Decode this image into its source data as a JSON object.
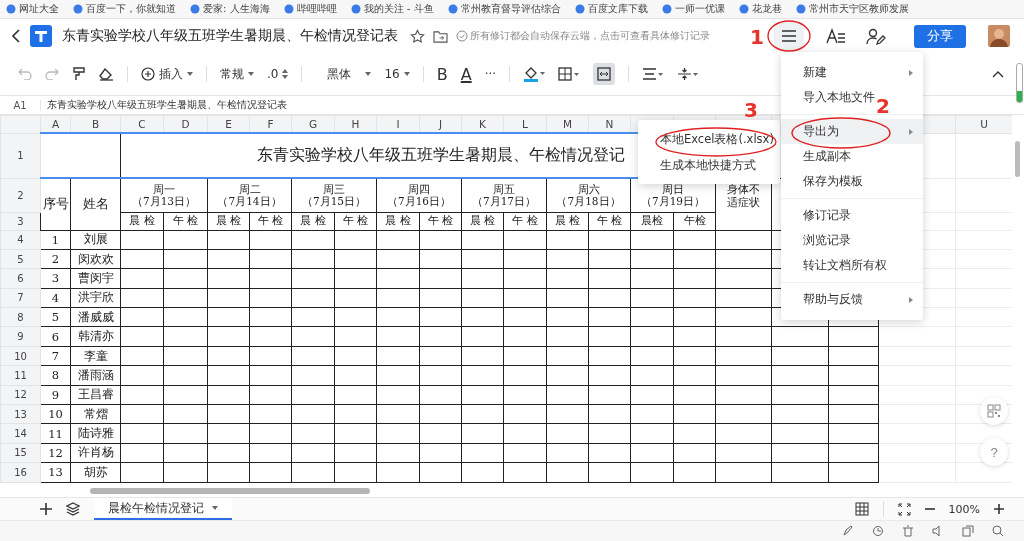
{
  "bookmarks": [
    {
      "label": "网址大全"
    },
    {
      "label": "百度一下，你就知道"
    },
    {
      "label": "爱家: 人生海海"
    },
    {
      "label": "哔哩哔哩"
    },
    {
      "label": "我的关注 - 斗鱼"
    },
    {
      "label": "常州教育督导评估综合"
    },
    {
      "label": "百度文库下载"
    },
    {
      "label": "一师一优课"
    },
    {
      "label": "花龙巷"
    },
    {
      "label": "常州市天宁区教师发展"
    }
  ],
  "header": {
    "title": "东青实验学校八年级五班学生暑期晨、午检情况登记表",
    "save_note": "所有修订都会自动保存云端，点击可查看具体修订记录",
    "share_button": "分享"
  },
  "toolbar": {
    "insert": "插入",
    "number_format": "常规",
    "decimal": ".0",
    "font": "黑体",
    "font_size": "16",
    "bold": "B",
    "font_color": "A",
    "more": "···",
    "merge_cells": {
      "on": true
    }
  },
  "formula_bar": {
    "cell": "A1",
    "content": "东青实验学校八年级五班学生暑期晨、午检情况登记表"
  },
  "columns": [
    "A",
    "B",
    "C",
    "D",
    "E",
    "F",
    "G",
    "H",
    "I",
    "J",
    "K",
    "L",
    "M",
    "N"
  ],
  "far_column": "U",
  "row_numbers": [
    "1",
    "2",
    "3",
    "4",
    "5",
    "6",
    "7",
    "8",
    "9",
    "10",
    "11",
    "12",
    "13",
    "14",
    "15",
    "16"
  ],
  "sheet": {
    "title": "东青实验学校八年级五班学生暑期晨、午检情况登记",
    "number_header": "序号",
    "name_header": "姓名",
    "symptoms_header": "身体不适症状",
    "days": [
      {
        "day": "周一",
        "date": "（7月13日）",
        "checks": [
          "晨 检",
          "午 检"
        ]
      },
      {
        "day": "周二",
        "date": "（7月14日）",
        "checks": [
          "晨 检",
          "午 检"
        ]
      },
      {
        "day": "周三",
        "date": "（7月15日）",
        "checks": [
          "晨 检",
          "午 检"
        ]
      },
      {
        "day": "周四",
        "date": "（7月16日）",
        "checks": [
          "晨 检",
          "午 检"
        ]
      },
      {
        "day": "周五",
        "date": "（7月17日）",
        "checks": [
          "晨 检",
          "午 检"
        ]
      },
      {
        "day": "周六",
        "date": "（7月18日）",
        "checks": [
          "晨 检",
          "午 检"
        ]
      },
      {
        "day": "周日",
        "date": "（7月19日）",
        "checks": [
          "晨检",
          "午检"
        ]
      }
    ],
    "students": [
      {
        "no": "1",
        "name": "刘展"
      },
      {
        "no": "2",
        "name": "闵欢欢"
      },
      {
        "no": "3",
        "name": "曹闵宇"
      },
      {
        "no": "4",
        "name": "洪宇欣"
      },
      {
        "no": "5",
        "name": "潘威威"
      },
      {
        "no": "6",
        "name": "韩清亦"
      },
      {
        "no": "7",
        "name": "李童"
      },
      {
        "no": "8",
        "name": "潘雨涵"
      },
      {
        "no": "9",
        "name": "王昌睿"
      },
      {
        "no": "10",
        "name": "常熠"
      },
      {
        "no": "11",
        "name": "陆诗雅"
      },
      {
        "no": "12",
        "name": "许肖杨"
      },
      {
        "no": "13",
        "name": "胡苏"
      }
    ]
  },
  "menu": {
    "groups": [
      [
        {
          "label": "新建",
          "submenu": true,
          "selected": false
        },
        {
          "label": "导入本地文件",
          "submenu": false,
          "selected": false
        }
      ],
      [
        {
          "label": "导出为",
          "submenu": true,
          "selected": true
        },
        {
          "label": "生成副本",
          "submenu": false,
          "selected": false
        },
        {
          "label": "保存为模板",
          "submenu": false,
          "selected": false
        }
      ],
      [
        {
          "label": "修订记录",
          "submenu": false,
          "selected": false
        },
        {
          "label": "浏览记录",
          "submenu": false,
          "selected": false
        },
        {
          "label": "转让文档所有权",
          "submenu": false,
          "selected": false
        }
      ],
      [
        {
          "label": "帮助与反馈",
          "submenu": true,
          "selected": false
        }
      ]
    ]
  },
  "submenu": {
    "items": [
      {
        "label": "本地Excel表格(.xlsx)"
      },
      {
        "label": "生成本地快捷方式"
      }
    ]
  },
  "annotations": [
    {
      "label": "1"
    },
    {
      "label": "2"
    },
    {
      "label": "3"
    }
  ],
  "help_button": "?",
  "sheet_tabs": [
    {
      "label": "晨检午检情况登记",
      "selected": true
    }
  ],
  "zoom": "100%"
}
